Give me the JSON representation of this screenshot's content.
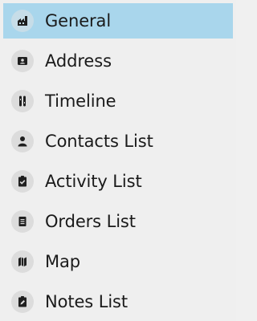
{
  "nav": {
    "selected_index": 0,
    "items": [
      {
        "label": "General",
        "icon": "industry-icon"
      },
      {
        "label": "Address",
        "icon": "contact-card-icon"
      },
      {
        "label": "Timeline",
        "icon": "timeline-icon"
      },
      {
        "label": "Contacts List",
        "icon": "person-icon"
      },
      {
        "label": "Activity List",
        "icon": "clipboard-check-icon"
      },
      {
        "label": "Orders List",
        "icon": "document-list-icon"
      },
      {
        "label": "Map",
        "icon": "map-icon"
      },
      {
        "label": "Notes List",
        "icon": "clipboard-edit-icon"
      }
    ]
  },
  "colors": {
    "selected_background": "#a9d6ec",
    "background": "#efefef",
    "icon_circle": "#dcdcdc",
    "icon_glyph": "#1f1f1f"
  }
}
